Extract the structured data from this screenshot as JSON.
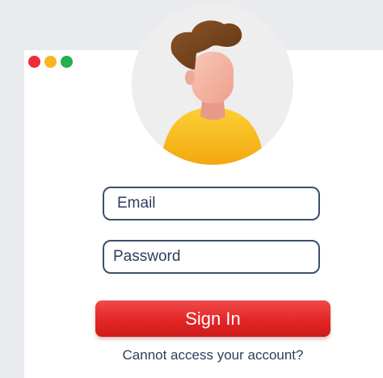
{
  "window_controls": {
    "close_color": "#ef2d3a",
    "minimize_color": "#f8b51d",
    "maximize_color": "#23b14b"
  },
  "avatar": {
    "icon": "user-avatar-icon",
    "hair_color": "#7a4620",
    "skin_color": "#f6b8a8",
    "shirt_color": "#f8c21f",
    "background_color": "#eeeeee"
  },
  "login_form": {
    "email_placeholder": "Email",
    "password_placeholder": "Password",
    "signin_label": "Sign In",
    "help_link": "Cannot access your account?"
  },
  "colors": {
    "accent": "#e32626",
    "text": "#2c3e5c",
    "field_border": "#3c4f6e"
  }
}
